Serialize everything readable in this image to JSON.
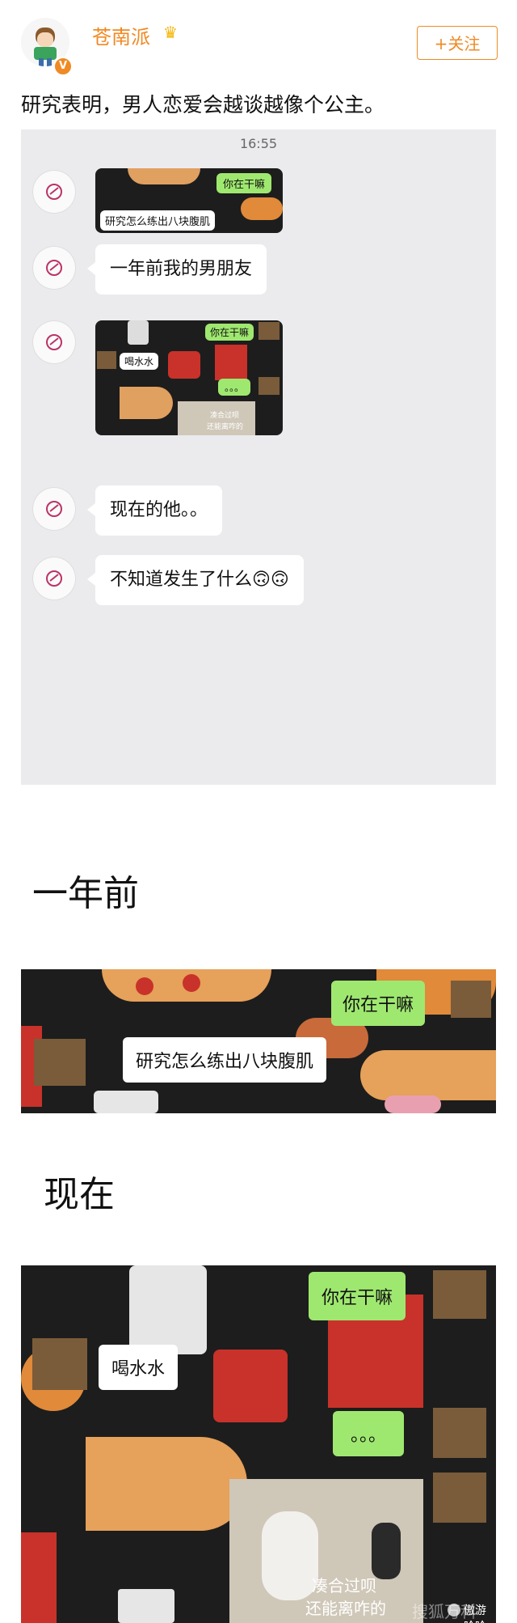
{
  "post": {
    "username": "苍南派",
    "follow_label": "+关注",
    "text": "研究表明，男人恋爱会越谈越像个公主。"
  },
  "chat": {
    "time": "16:55",
    "messages": [
      {
        "type": "image",
        "green": "你在干嘛",
        "white": "研究怎么练出八块腹肌"
      },
      {
        "type": "text",
        "text": "一年前我的男朋友"
      },
      {
        "type": "image",
        "green": "你在干嘛",
        "white": "喝水水",
        "dots": "。。。",
        "caption1": "凑合过呗",
        "caption2": "还能离咋的"
      },
      {
        "type": "text",
        "text": "现在的他。。"
      },
      {
        "type": "text",
        "text": "不知道发生了什么🙃🙃"
      }
    ]
  },
  "section1": {
    "label": "一年前",
    "green": "你在干嘛",
    "white": "研究怎么练出八块腹肌"
  },
  "section2": {
    "label": "现在",
    "green": "你在干嘛",
    "white": "喝水水",
    "dots": "。。。",
    "caption1": "凑合过呗",
    "caption2": "还能离咋的"
  },
  "watermark": {
    "left": "搜狐万科",
    "right": "傲游哈哈"
  },
  "colors": {
    "accent": "#f08a24",
    "green_bubble": "#9fe870",
    "chat_bg": "#ebebee",
    "food_bg": "#1d1d1d"
  }
}
